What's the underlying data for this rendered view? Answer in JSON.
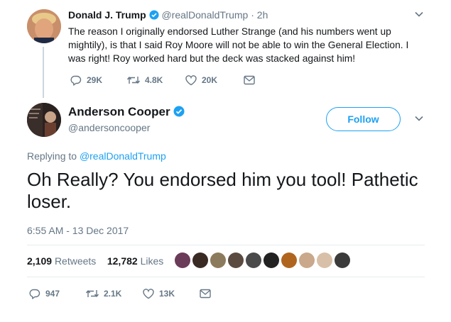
{
  "tweet1": {
    "display_name": "Donald J. Trump",
    "handle": "@realDonaldTrump",
    "separator": "·",
    "time": "2h",
    "text": "The reason I originally endorsed Luther Strange (and his numbers went up mightily), is that I said Roy Moore will not be able to win the General Election.  I was right! Roy worked hard but the deck was stacked against him!",
    "replies": "29K",
    "retweets": "4.8K",
    "likes": "20K"
  },
  "tweet2": {
    "display_name": "Anderson Cooper",
    "handle": "@andersoncooper",
    "follow_label": "Follow",
    "replying_prefix": "Replying to",
    "replying_handle": "@realDonaldTrump",
    "text": "Oh Really? You endorsed him you tool! Pathetic loser.",
    "timestamp": "6:55 AM - 13 Dec 2017",
    "retweet_count": "2,109",
    "retweet_label": "Retweets",
    "like_count": "12,782",
    "like_label": "Likes",
    "replies": "947",
    "retweets": "2.1K",
    "likes": "13K"
  },
  "colors": {
    "accent": "#1da1f2",
    "muted": "#657786",
    "text": "#14171a",
    "divider": "#e6ecf0"
  },
  "icons": [
    "verified-icon",
    "chevron-down-icon",
    "reply-icon",
    "retweet-icon",
    "like-icon",
    "direct-message-icon"
  ],
  "likers": [
    "#6b3b5a",
    "#3a2a24",
    "#8c7a5c",
    "#5a4a40",
    "#4a4a4a",
    "#222222",
    "#b0651f",
    "#c9a88c",
    "#d8c0a8",
    "#3b3b3b"
  ]
}
